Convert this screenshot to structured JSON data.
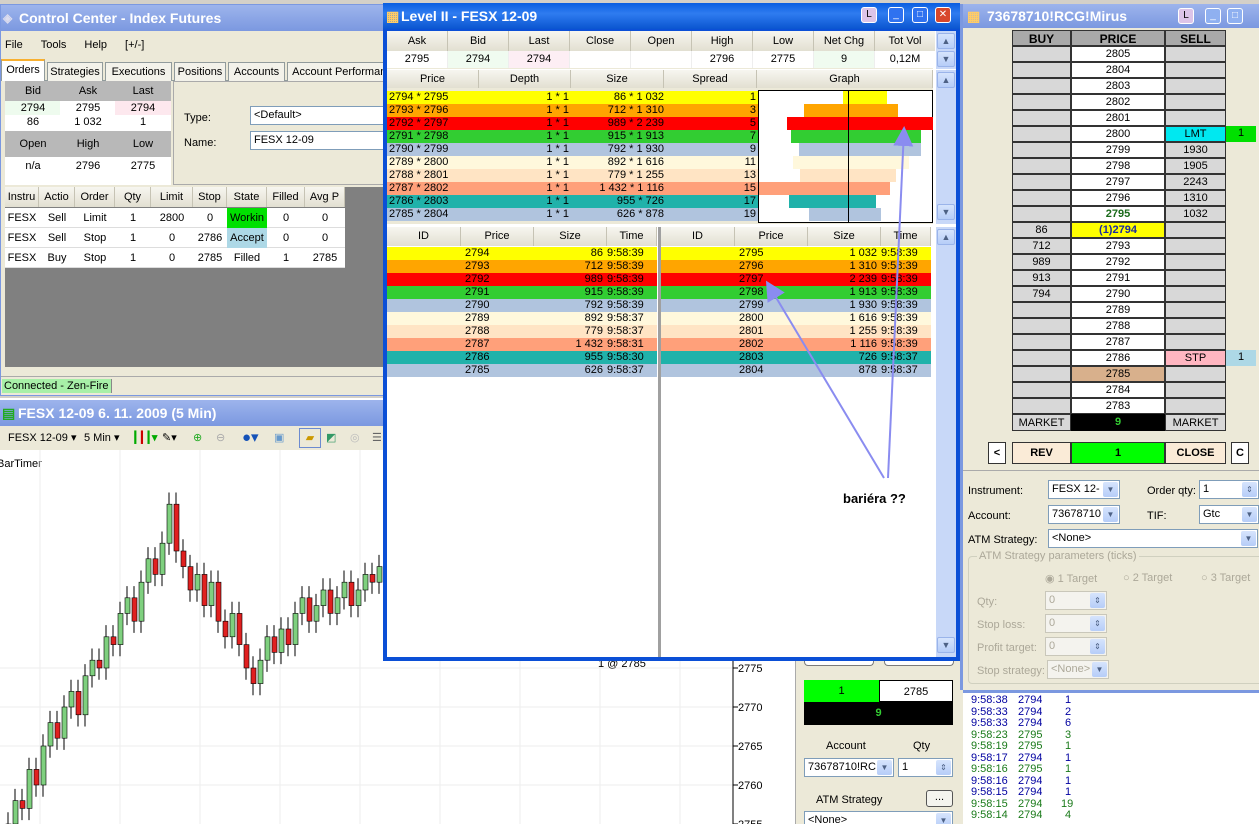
{
  "control_center": {
    "title": "Control Center - Index Futures",
    "menu": [
      "File",
      "Tools",
      "Help",
      "[+/-]"
    ],
    "tabs": [
      "Orders",
      "Strategies",
      "Executions",
      "Positions",
      "Accounts",
      "Account Performanc"
    ],
    "quote": {
      "h1": [
        "Bid",
        "Ask",
        "Last"
      ],
      "v1": [
        "2794",
        "2795",
        "2794"
      ],
      "v2": [
        "86",
        "1 032",
        "1"
      ],
      "h2": [
        "Open",
        "High",
        "Low"
      ],
      "v3": [
        "n/a",
        "2796",
        "2775"
      ]
    },
    "type_label": "Type:",
    "type_value": "<Default>",
    "name_label": "Name:",
    "name_value": "FESX 12-09",
    "orders": {
      "columns": [
        "Instru",
        "Actio",
        "Order",
        "Qty",
        "Limit",
        "Stop",
        "State",
        "Filled",
        "Avg P"
      ],
      "rows": [
        [
          "FESX",
          "Sell",
          "Limit",
          "1",
          "2800",
          "0",
          "Workin",
          "0",
          "0"
        ],
        [
          "FESX",
          "Sell",
          "Stop",
          "1",
          "0",
          "2786",
          "Accept",
          "0",
          "0"
        ],
        [
          "FESX",
          "Buy",
          "Stop",
          "1",
          "0",
          "2785",
          "Filled",
          "1",
          "2785"
        ]
      ]
    },
    "status": "Connected - Zen-Fire"
  },
  "chart": {
    "title": "FESX 12-09  6. 11. 2009 (5 Min)",
    "instrument": "FESX 12-09",
    "interval": "5 Min",
    "indicator": "BarTimer",
    "fill_marker": "1 @ 2785",
    "chart_data": {
      "type": "candlestick",
      "y_ticks": [
        "2775",
        "2770",
        "2765",
        "2760",
        "2755"
      ],
      "close": [
        2755,
        2758,
        2757,
        2762,
        2760,
        2765,
        2768,
        2766,
        2770,
        2772,
        2769,
        2774,
        2776,
        2775,
        2779,
        2778,
        2782,
        2784,
        2781,
        2786,
        2789,
        2787,
        2791,
        2796,
        2790,
        2788,
        2785,
        2787,
        2783,
        2786,
        2781,
        2779,
        2782,
        2778,
        2775,
        2773,
        2776,
        2779,
        2777,
        2780,
        2778,
        2782,
        2784,
        2781,
        2783,
        2785,
        2782,
        2784,
        2786,
        2783,
        2785,
        2787,
        2786,
        2788
      ]
    }
  },
  "chart_trader": {
    "position_qty": "1",
    "position_price": "2785",
    "pnl": "9",
    "account_label": "Account",
    "account_value": "73678710!RC",
    "qty_label": "Qty",
    "qty_value": "1",
    "atm_label": "ATM Strategy",
    "atm_btn": "...",
    "atm_value": "<None>"
  },
  "level2": {
    "title": "Level II - FESX 12-09",
    "quote_headers": [
      "Ask",
      "Bid",
      "Last",
      "Close",
      "Open",
      "High",
      "Low",
      "Net Chg",
      "Tot Vol"
    ],
    "quote_values": [
      "2795",
      "2794",
      "2794",
      "",
      "",
      "2796",
      "2775",
      "9",
      "0,12M"
    ],
    "ladder_headers": [
      "Price",
      "Depth",
      "Size",
      "Spread",
      "Graph"
    ],
    "ladder": [
      {
        "price": "2794 * 2795",
        "depth": "1 * 1",
        "size": "86 * 1 032",
        "spread": "1",
        "bid": 86,
        "ask": 1032,
        "color": "#ffff00"
      },
      {
        "price": "2793 * 2796",
        "depth": "1 * 1",
        "size": "712 * 1 310",
        "spread": "3",
        "bid": 712,
        "ask": 1310,
        "color": "#ffa500"
      },
      {
        "price": "2792 * 2797",
        "depth": "1 * 1",
        "size": "989 * 2 239",
        "spread": "5",
        "bid": 989,
        "ask": 2239,
        "color": "#ff0000"
      },
      {
        "price": "2791 * 2798",
        "depth": "1 * 1",
        "size": "915 * 1 913",
        "spread": "7",
        "bid": 915,
        "ask": 1913,
        "color": "#32cd32"
      },
      {
        "price": "2790 * 2799",
        "depth": "1 * 1",
        "size": "792 * 1 930",
        "spread": "9",
        "bid": 792,
        "ask": 1930,
        "color": "#b0c4de"
      },
      {
        "price": "2789 * 2800",
        "depth": "1 * 1",
        "size": "892 * 1 616",
        "spread": "11",
        "bid": 892,
        "ask": 1616,
        "color": "#fff8dc"
      },
      {
        "price": "2788 * 2801",
        "depth": "1 * 1",
        "size": "779 * 1 255",
        "spread": "13",
        "bid": 779,
        "ask": 1255,
        "color": "#ffe4c4"
      },
      {
        "price": "2787 * 2802",
        "depth": "1 * 1",
        "size": "1 432 * 1 116",
        "spread": "15",
        "bid": 1432,
        "ask": 1116,
        "color": "#ffa07a"
      },
      {
        "price": "2786 * 2803",
        "depth": "1 * 1",
        "size": "955 * 726",
        "spread": "17",
        "bid": 955,
        "ask": 726,
        "color": "#20b2aa"
      },
      {
        "price": "2785 * 2804",
        "depth": "1 * 1",
        "size": "626 * 878",
        "spread": "19",
        "bid": 626,
        "ask": 878,
        "color": "#b0c4de"
      }
    ],
    "book_headers": [
      "ID",
      "Price",
      "Size",
      "Time"
    ],
    "bids": [
      [
        "2794",
        "86",
        "9:58:39"
      ],
      [
        "2793",
        "712",
        "9:58:39"
      ],
      [
        "2792",
        "989",
        "9:58:39"
      ],
      [
        "2791",
        "915",
        "9:58:39"
      ],
      [
        "2790",
        "792",
        "9:58:39"
      ],
      [
        "2789",
        "892",
        "9:58:37"
      ],
      [
        "2788",
        "779",
        "9:58:37"
      ],
      [
        "2787",
        "1 432",
        "9:58:31"
      ],
      [
        "2786",
        "955",
        "9:58:30"
      ],
      [
        "2785",
        "626",
        "9:58:37"
      ]
    ],
    "asks": [
      [
        "2795",
        "1 032",
        "9:58:39"
      ],
      [
        "2796",
        "1 310",
        "9:58:39"
      ],
      [
        "2797",
        "2 239",
        "9:58:39"
      ],
      [
        "2798",
        "1 913",
        "9:58:39"
      ],
      [
        "2799",
        "1 930",
        "9:58:39"
      ],
      [
        "2800",
        "1 616",
        "9:58:39"
      ],
      [
        "2801",
        "1 255",
        "9:58:39"
      ],
      [
        "2802",
        "1 116",
        "9:58:39"
      ],
      [
        "2803",
        "726",
        "9:58:37"
      ],
      [
        "2804",
        "878",
        "9:58:37"
      ]
    ],
    "annotation": "bariéra ??"
  },
  "dom": {
    "title": "73678710!RCG!Mirus",
    "headers": [
      "BUY",
      "PRICE",
      "SELL"
    ],
    "rows": [
      {
        "buy": "",
        "price": "2805",
        "sell": ""
      },
      {
        "buy": "",
        "price": "2804",
        "sell": ""
      },
      {
        "buy": "",
        "price": "2803",
        "sell": ""
      },
      {
        "buy": "",
        "price": "2802",
        "sell": ""
      },
      {
        "buy": "",
        "price": "2801",
        "sell": ""
      },
      {
        "buy": "",
        "price": "2800",
        "sell": "LMT",
        "order": "1",
        "kind": "lmt"
      },
      {
        "buy": "",
        "price": "2799",
        "sell": "1930"
      },
      {
        "buy": "",
        "price": "2798",
        "sell": "1905"
      },
      {
        "buy": "",
        "price": "2797",
        "sell": "2243"
      },
      {
        "buy": "",
        "price": "2796",
        "sell": "1310"
      },
      {
        "buy": "",
        "price": "2795",
        "sell": "1032",
        "kind": "ask"
      },
      {
        "buy": "86",
        "price": "(1)2794",
        "sell": "",
        "kind": "last"
      },
      {
        "buy": "712",
        "price": "2793",
        "sell": ""
      },
      {
        "buy": "989",
        "price": "2792",
        "sell": ""
      },
      {
        "buy": "913",
        "price": "2791",
        "sell": ""
      },
      {
        "buy": "794",
        "price": "2790",
        "sell": ""
      },
      {
        "buy": "",
        "price": "2789",
        "sell": ""
      },
      {
        "buy": "",
        "price": "2788",
        "sell": ""
      },
      {
        "buy": "",
        "price": "2787",
        "sell": ""
      },
      {
        "buy": "",
        "price": "2786",
        "sell": "STP",
        "order": "1",
        "kind": "stp"
      },
      {
        "buy": "",
        "price": "2785",
        "sell": "",
        "kind": "entry"
      },
      {
        "buy": "",
        "price": "2784",
        "sell": ""
      },
      {
        "buy": "",
        "price": "2783",
        "sell": ""
      }
    ],
    "market_buy": "MARKET",
    "pnl": "9",
    "market_sell": "MARKET",
    "btn_left": "<",
    "btn_rev": "REV",
    "btn_qty": "1",
    "btn_close": "CLOSE",
    "btn_c": "C",
    "form": {
      "instrument_label": "Instrument:",
      "instrument": "FESX 12-",
      "order_qty_label": "Order qty:",
      "order_qty": "1",
      "account_label": "Account:",
      "account": "73678710",
      "tif_label": "TIF:",
      "tif": "Gtc",
      "atm_label": "ATM Strategy:",
      "atm": "<None>",
      "params_label": "ATM Strategy parameters (ticks)",
      "targets": [
        "1 Target",
        "2 Target",
        "3 Target"
      ],
      "qty_label": "Qty:",
      "qty": "0",
      "stop_loss_label": "Stop loss:",
      "stop_loss": "0",
      "profit_label": "Profit target:",
      "profit": "0",
      "stop_strategy_label": "Stop strategy:",
      "stop_strategy": "<None>"
    },
    "tape": [
      [
        "9:58:38",
        "2794",
        "1",
        "b"
      ],
      [
        "9:58:33",
        "2794",
        "2",
        "b"
      ],
      [
        "9:58:33",
        "2794",
        "6",
        "b"
      ],
      [
        "9:58:23",
        "2795",
        "3",
        "g"
      ],
      [
        "9:58:19",
        "2795",
        "1",
        "g"
      ],
      [
        "9:58:17",
        "2794",
        "1",
        "b"
      ],
      [
        "9:58:16",
        "2795",
        "1",
        "g"
      ],
      [
        "9:58:16",
        "2794",
        "1",
        "b"
      ],
      [
        "9:58:15",
        "2794",
        "1",
        "b"
      ],
      [
        "9:58:15",
        "2794",
        "19",
        "g"
      ],
      [
        "9:58:14",
        "2794",
        "4",
        "g"
      ]
    ]
  }
}
